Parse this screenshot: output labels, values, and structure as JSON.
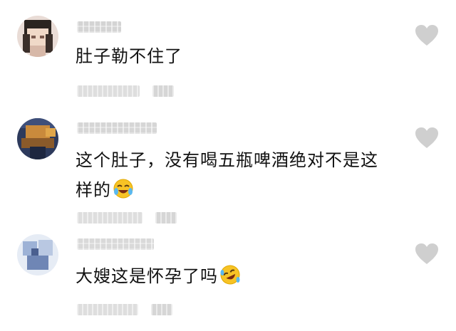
{
  "comments": [
    {
      "username": "■■■■■",
      "text": "肚子勒不住了",
      "emoji": "",
      "time": "■■■■■",
      "reply": "■■"
    },
    {
      "username": "■■■■■■■",
      "text": "这个肚子，没有喝五瓶啤酒绝对不是这样的",
      "emoji": "crying-laughing-emoji",
      "time": "■■■■■■",
      "reply": "■■"
    },
    {
      "username": "■■■■■■",
      "text": "大嫂这是怀孕了吗",
      "emoji": "rofl-emoji",
      "time": "■■■■■■",
      "reply": "■■"
    }
  ],
  "icons": {
    "like": "heart-icon"
  },
  "colors": {
    "heart": "#cfcfcf",
    "text": "#111111",
    "pixelated": "#dcdcdc",
    "emoji_face": "#f7c325"
  }
}
